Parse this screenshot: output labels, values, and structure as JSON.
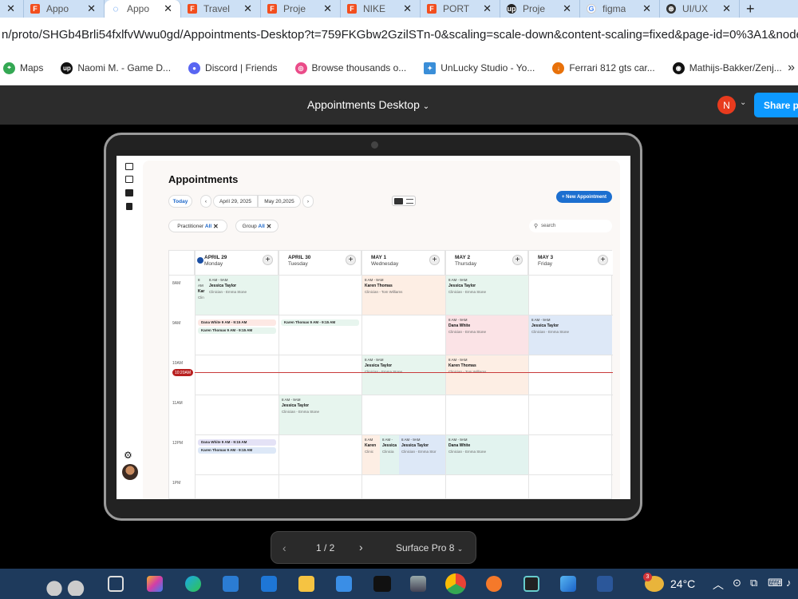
{
  "browser": {
    "tabs": [
      {
        "title": "",
        "icon": "figma-icon",
        "closable": true
      },
      {
        "title": "Appo",
        "icon": "figma-icon",
        "closable": true
      },
      {
        "title": "Appo",
        "icon": "loading-icon",
        "closable": true,
        "active": true
      },
      {
        "title": "Travel",
        "icon": "figma-icon",
        "closable": true
      },
      {
        "title": "Proje",
        "icon": "figma-icon",
        "closable": true
      },
      {
        "title": "NIKE",
        "icon": "figma-icon",
        "closable": true
      },
      {
        "title": "PORT",
        "icon": "figma-icon",
        "closable": true
      },
      {
        "title": "Proje",
        "icon": "upwork-icon",
        "closable": true
      },
      {
        "title": "figma",
        "icon": "google-icon",
        "closable": true
      },
      {
        "title": "UI/UX",
        "icon": "chatgpt-icon",
        "closable": true
      }
    ],
    "new_tab": "+",
    "url": "n/proto/SHGb4Brli54fxlfvWwu0gd/Appointments-Desktop?t=759FKGbw2GzilSTn-0&scaling=scale-down&content-scaling=fixed&page-id=0%3A1&node-id=50-2",
    "bookmarks": [
      {
        "label": "Maps",
        "icon": "maps-icon"
      },
      {
        "label": "Naomi M. - Game D...",
        "icon": "upwork-icon"
      },
      {
        "label": "Discord | Friends",
        "icon": "discord-icon"
      },
      {
        "label": "Browse thousands o...",
        "icon": "dribbble-icon"
      },
      {
        "label": "UnLucky Studio - Yo...",
        "icon": "unlucky-icon"
      },
      {
        "label": "Ferrari 812 gts car...",
        "icon": "download-icon"
      },
      {
        "label": "Mathijs-Bakker/Zenj...",
        "icon": "github-icon"
      }
    ],
    "bookmarks_more": "»"
  },
  "figma": {
    "title": "Appointments Desktop",
    "avatar_letter": "N",
    "share_label": "Share pr"
  },
  "app": {
    "title": "Appointments",
    "today": "Today",
    "date_from": "April 29, 2025",
    "date_to": "May 20,2025",
    "new_appointment": "+ New Appointment",
    "filter_practitioner": "Practitioner",
    "filter_group": "Group",
    "filter_all": "All",
    "search_placeholder": "search",
    "now_label": "10:20AM",
    "days": [
      {
        "date": "APRIL 29",
        "weekday": "Monday",
        "current": true
      },
      {
        "date": "APRIL 30",
        "weekday": "Tuesday"
      },
      {
        "date": "MAY 1",
        "weekday": "Wednesday"
      },
      {
        "date": "MAY 2",
        "weekday": "Thursday"
      },
      {
        "date": "MAY 3",
        "weekday": "Friday"
      }
    ],
    "times": [
      "8AM",
      "9AM",
      "10AM",
      "11AM",
      "12PM",
      "1PM"
    ],
    "event_text": {
      "time": "8 AM - 9AM",
      "kar": "Kar",
      "clin": "Clin",
      "clinic": "Clinic",
      "karen": "Karen",
      "dana_9": "Dana White 9 AM - 9:15 AM",
      "karen_9": "Karen Thomas 9 AM - 9:15 AM",
      "jessica": "Jessica Taylor",
      "karen_full": "Karen Thomas",
      "dana": "Dana White",
      "emma": "Clinician - Emma Stone",
      "tom": "Clinician - Tom Williams",
      "clin_short": "Clinicia",
      "emma_cut": "Clinician - Emma Stor",
      "jessi": "Jessica",
      "time_short": "8 AM -",
      "time_8": "8 AM"
    },
    "colors": {
      "green": "#e7f5ee",
      "pink": "#fde8e4",
      "peach": "#fdeee4",
      "blue": "#dde8f7",
      "teal": "#e2f3ef",
      "lavender": "#e4e2f6",
      "accent": "#1c6fd0",
      "now": "#b82020"
    }
  },
  "pager": {
    "page": "1 / 2",
    "device": "Surface Pro 8"
  },
  "taskbar": {
    "temperature": "24°C",
    "weather_badge": "3"
  }
}
